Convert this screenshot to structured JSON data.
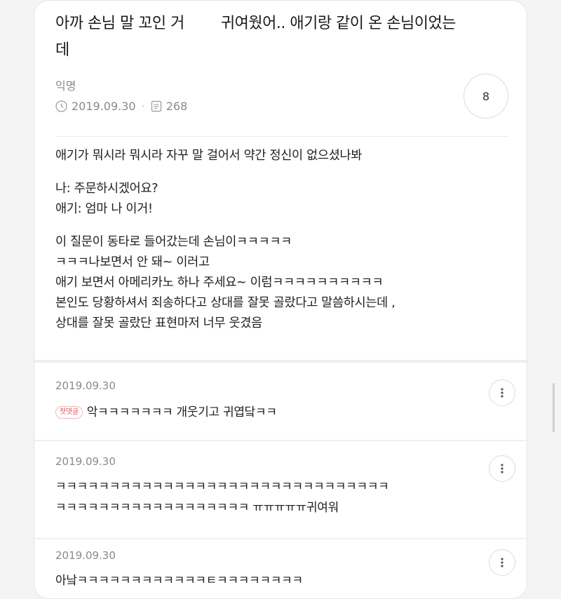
{
  "post": {
    "title_part1": "아까 손님 말 꼬인 거",
    "title_part2": "귀여웠어.. 애기랑 같이 온 손님이었는",
    "title_line2": "데",
    "author": "익명",
    "date": "2019.09.30",
    "views": "268",
    "comment_count": "8",
    "body": [
      [
        "애기가 뭐시라 뭐시라 자꾸 말 걸어서 약간 정신이 없으셨나봐"
      ],
      [
        "나: 주문하시겠어요?",
        "애기: 엄마 나 이거!"
      ],
      [
        "이 질문이 동타로 들어갔는데 손님이ㅋㅋㅋㅋㅋ",
        "ㅋㅋㅋ나보면서 안 돼~ 이러고",
        "애기 보면서 아메리카노 하나 주세요~ 이럼ㅋㅋㅋㅋㅋㅋㅋㅋㅋㅋ",
        "본인도 당황하셔서 죄송하다고 상대를 잘못 골랐다고 말씀하시는데 ,",
        "상대를 잘못 골랐단 표현마저 너무 웃겼음"
      ]
    ]
  },
  "comments": [
    {
      "date": "2019.09.30",
      "badge": "첫댓글",
      "lines": [
        "악ㅋㅋㅋㅋㅋㅋㅋ 개웃기고 귀엽닼ㅋㅋ"
      ]
    },
    {
      "date": "2019.09.30",
      "badge": "",
      "lines": [
        "ㅋㅋㅋㅋㅋㅋㅋㅋㅋㅋㅋㅋㅋㅋㅋㅋㅋㅋㅋㅋㅋㅋㅋㅋㅋㅋㅋㅋㅋㅋㅋ",
        "ㅋㅋㅋㅋㅋㅋㅋㅋㅋㅋㅋㅋㅋㅋㅋㅋㅋㅋ ㅠㅠㅠㅠㅠ귀여워"
      ]
    },
    {
      "date": "2019.09.30",
      "badge": "",
      "lines": [
        "아낰ㅋㅋㅋㅋㅋㅋㅋㅋㅋㅋㅋㅋㅌㅋㅋㅋㅋㅋㅋㅋㅋ"
      ]
    }
  ],
  "icons": {
    "date": "clock-icon",
    "views": "document-icon",
    "menu": "more-vertical-icon"
  }
}
